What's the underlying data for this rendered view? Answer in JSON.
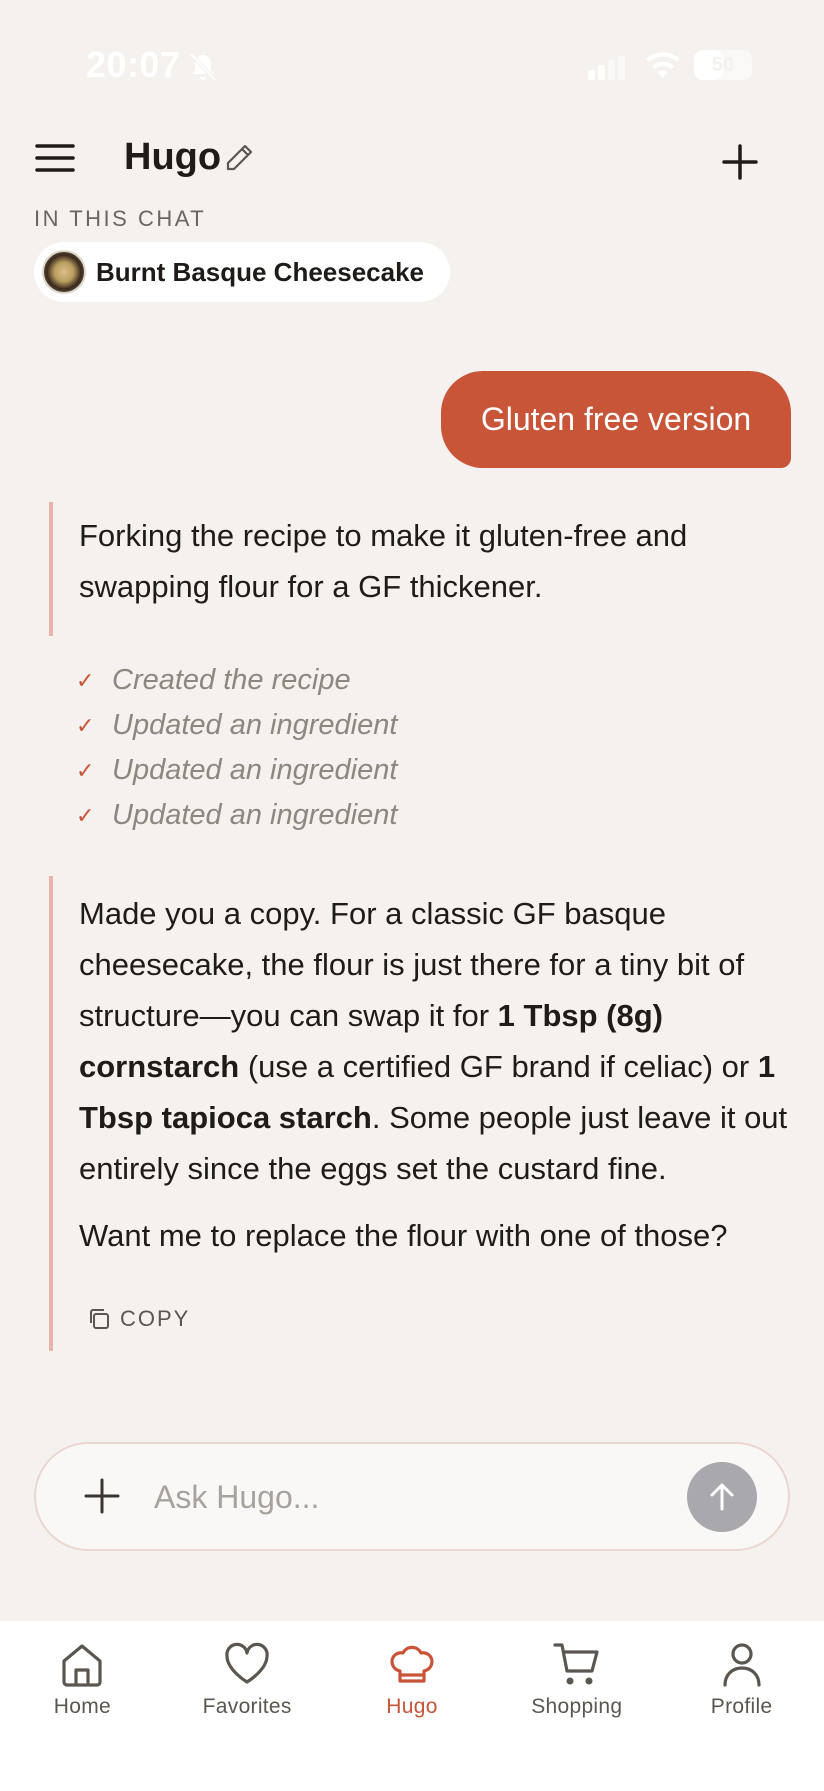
{
  "status_bar": {
    "time": "20:07",
    "battery": "50",
    "battery_level": 0.5
  },
  "header": {
    "title": "Hugo",
    "menu_icon": "hamburger-menu-icon",
    "edit_icon": "pencil-icon",
    "new_icon": "plus-icon"
  },
  "context": {
    "label": "IN THIS CHAT",
    "recipe_name": "Burnt Basque Cheesecake"
  },
  "messages": {
    "user_1": "Gluten free version",
    "assistant_1": "Forking the recipe to make it gluten-free and swapping flour for a GF thickener.",
    "actions": [
      "Created the recipe",
      "Updated an ingredient",
      "Updated an ingredient",
      "Updated an ingredient"
    ],
    "assistant_2": {
      "part1": "Made you a copy. For a classic GF basque cheesecake, the flour is just there for a tiny bit of structure—you can swap it for ",
      "bold1": "1 Tbsp (8g) cornstarch",
      "part2": " (use a certified GF brand if celiac) or ",
      "bold2": "1 Tbsp tapioca starch",
      "part3": ". Some people just leave it out entirely since the eggs set the custard fine.",
      "followup": "Want me to replace the flour with one of those?"
    },
    "copy_label": "COPY"
  },
  "composer": {
    "placeholder": "Ask Hugo..."
  },
  "nav": {
    "items": [
      {
        "label": "Home",
        "icon": "home-icon"
      },
      {
        "label": "Favorites",
        "icon": "heart-icon"
      },
      {
        "label": "Hugo",
        "icon": "chef-hat-icon"
      },
      {
        "label": "Shopping",
        "icon": "cart-icon"
      },
      {
        "label": "Profile",
        "icon": "person-icon"
      }
    ],
    "active": "Hugo"
  },
  "colors": {
    "accent": "#c85538",
    "background": "#f4f1ee",
    "quote_border": "#e8b3a8"
  }
}
